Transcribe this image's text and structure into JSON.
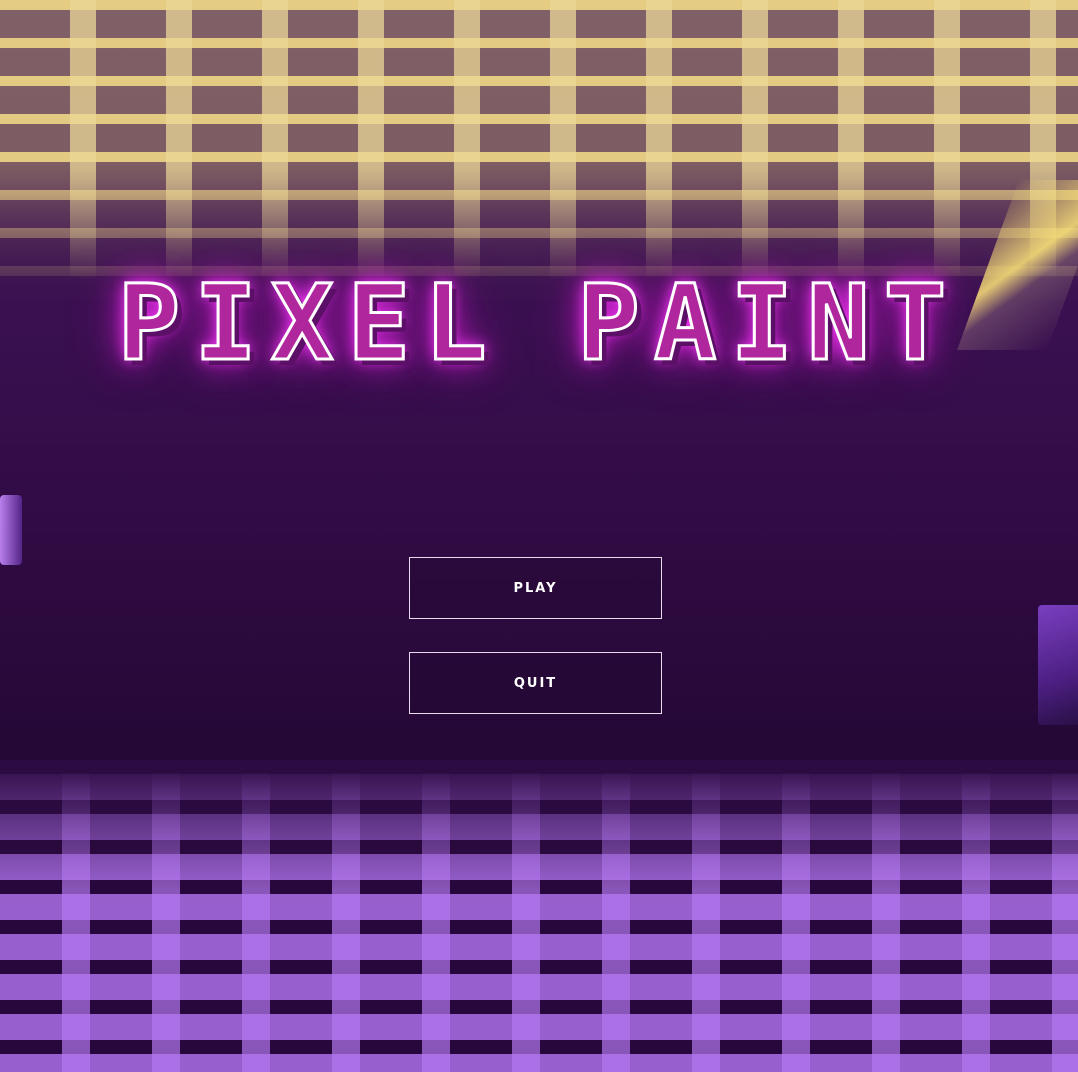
{
  "game": {
    "title": "PIXEL PAINT"
  },
  "menu": {
    "play_label": "PLAY",
    "quit_label": "QUIT"
  },
  "colors": {
    "background": "#3a1050",
    "title_glow": "#ff3cff",
    "ceiling_grid": "#d9c38a",
    "floor_grid": "#aa6ee6"
  }
}
